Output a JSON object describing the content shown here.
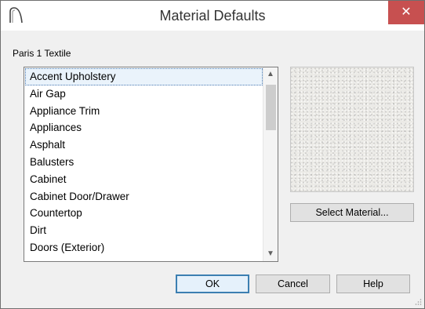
{
  "window": {
    "title": "Material Defaults",
    "close_glyph": "✕"
  },
  "material_name": "Paris 1 Textile",
  "list": {
    "items": [
      {
        "label": "Accent Upholstery",
        "selected": true
      },
      {
        "label": "Air Gap"
      },
      {
        "label": "Appliance Trim"
      },
      {
        "label": "Appliances"
      },
      {
        "label": "Asphalt"
      },
      {
        "label": "Balusters"
      },
      {
        "label": "Cabinet"
      },
      {
        "label": "Cabinet Door/Drawer"
      },
      {
        "label": "Countertop"
      },
      {
        "label": "Dirt"
      },
      {
        "label": "Doors (Exterior)"
      }
    ],
    "scroll_up_glyph": "▲",
    "scroll_down_glyph": "▼"
  },
  "buttons": {
    "select_material": "Select Material...",
    "ok": "OK",
    "cancel": "Cancel",
    "help": "Help"
  },
  "colors": {
    "close_bg": "#c75050",
    "selection_bg": "#eaf3fb",
    "default_button_border": "#3c7fb1"
  }
}
